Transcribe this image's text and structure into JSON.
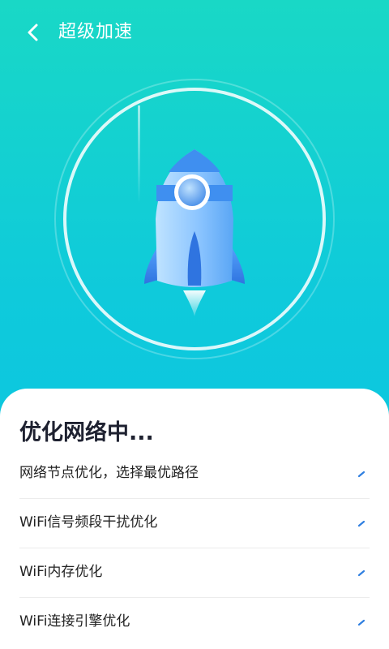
{
  "header": {
    "title": "超级加速",
    "back_icon": "chevron-left-icon"
  },
  "hero": {
    "icon": "rocket-icon"
  },
  "sheet": {
    "title": "优化网络中...",
    "items": [
      {
        "label": "网络节点优化，选择最优路径",
        "status_icon": "loading-tick-icon"
      },
      {
        "label": "WiFi信号频段干扰优化",
        "status_icon": "loading-tick-icon"
      },
      {
        "label": "WiFi内存优化",
        "status_icon": "loading-tick-icon"
      },
      {
        "label": "WiFi连接引擎优化",
        "status_icon": "loading-tick-icon"
      }
    ]
  },
  "colors": {
    "background_top": "#19d8c6",
    "background_bottom": "#08c2e6",
    "rocket_primary": "#3f8ff0",
    "status_accent": "#2f7fe0",
    "title_text": "#1e2130"
  }
}
